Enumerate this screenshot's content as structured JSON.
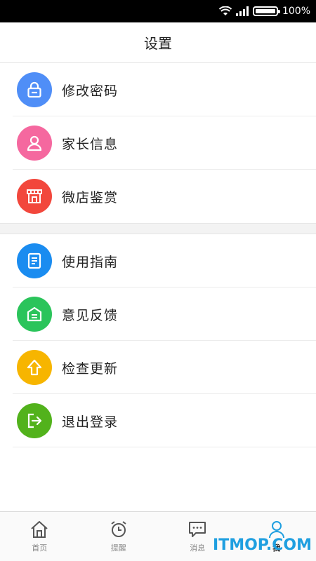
{
  "status_bar": {
    "battery_text": "100%",
    "icons": [
      "wifi-icon",
      "signal-icon",
      "battery-icon"
    ]
  },
  "header": {
    "title": "设置"
  },
  "group1": [
    {
      "label": "修改密码",
      "icon": "lock-icon",
      "color": "#4f8ef7"
    },
    {
      "label": "家长信息",
      "icon": "user-icon",
      "color": "#f5689f"
    },
    {
      "label": "微店鉴赏",
      "icon": "store-icon",
      "color": "#f2473c"
    }
  ],
  "group2": [
    {
      "label": "使用指南",
      "icon": "document-icon",
      "color": "#1a8cf0"
    },
    {
      "label": "意见反馈",
      "icon": "feedback-icon",
      "color": "#2bc45b"
    },
    {
      "label": "检查更新",
      "icon": "arrow-up-icon",
      "color": "#f7b500"
    },
    {
      "label": "退出登录",
      "icon": "logout-icon",
      "color": "#52b21c"
    }
  ],
  "bottom_nav": [
    {
      "label": "首页",
      "icon": "home-icon",
      "active": false
    },
    {
      "label": "提醒",
      "icon": "alarm-clock-icon",
      "active": false
    },
    {
      "label": "消息",
      "icon": "chat-icon",
      "active": false
    },
    {
      "label": "我",
      "icon": "person-icon",
      "active": true
    }
  ],
  "watermark": "ITMOP.COM"
}
